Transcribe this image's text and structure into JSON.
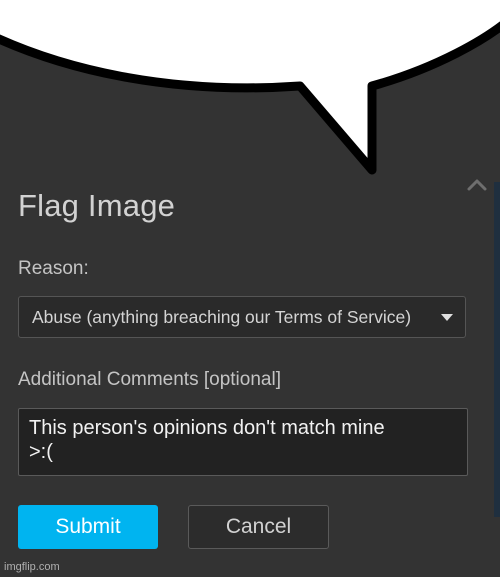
{
  "dialog": {
    "title": "Flag Image",
    "reason_label": "Reason:",
    "reason_selected": "Abuse (anything breaching our Terms of Service)",
    "comments_label": "Additional Comments [optional]",
    "comments_value": "This person's opinions don't match mine\n>:(",
    "submit_label": "Submit",
    "cancel_label": "Cancel"
  },
  "icons": {
    "collapse": "chevron-up-icon",
    "dropdown": "caret-down-icon"
  },
  "watermark": "imgflip.com",
  "colors": {
    "background": "#333333",
    "submit": "#00b4f0",
    "bubble_fill": "#ffffff",
    "bubble_outline": "#000000"
  }
}
